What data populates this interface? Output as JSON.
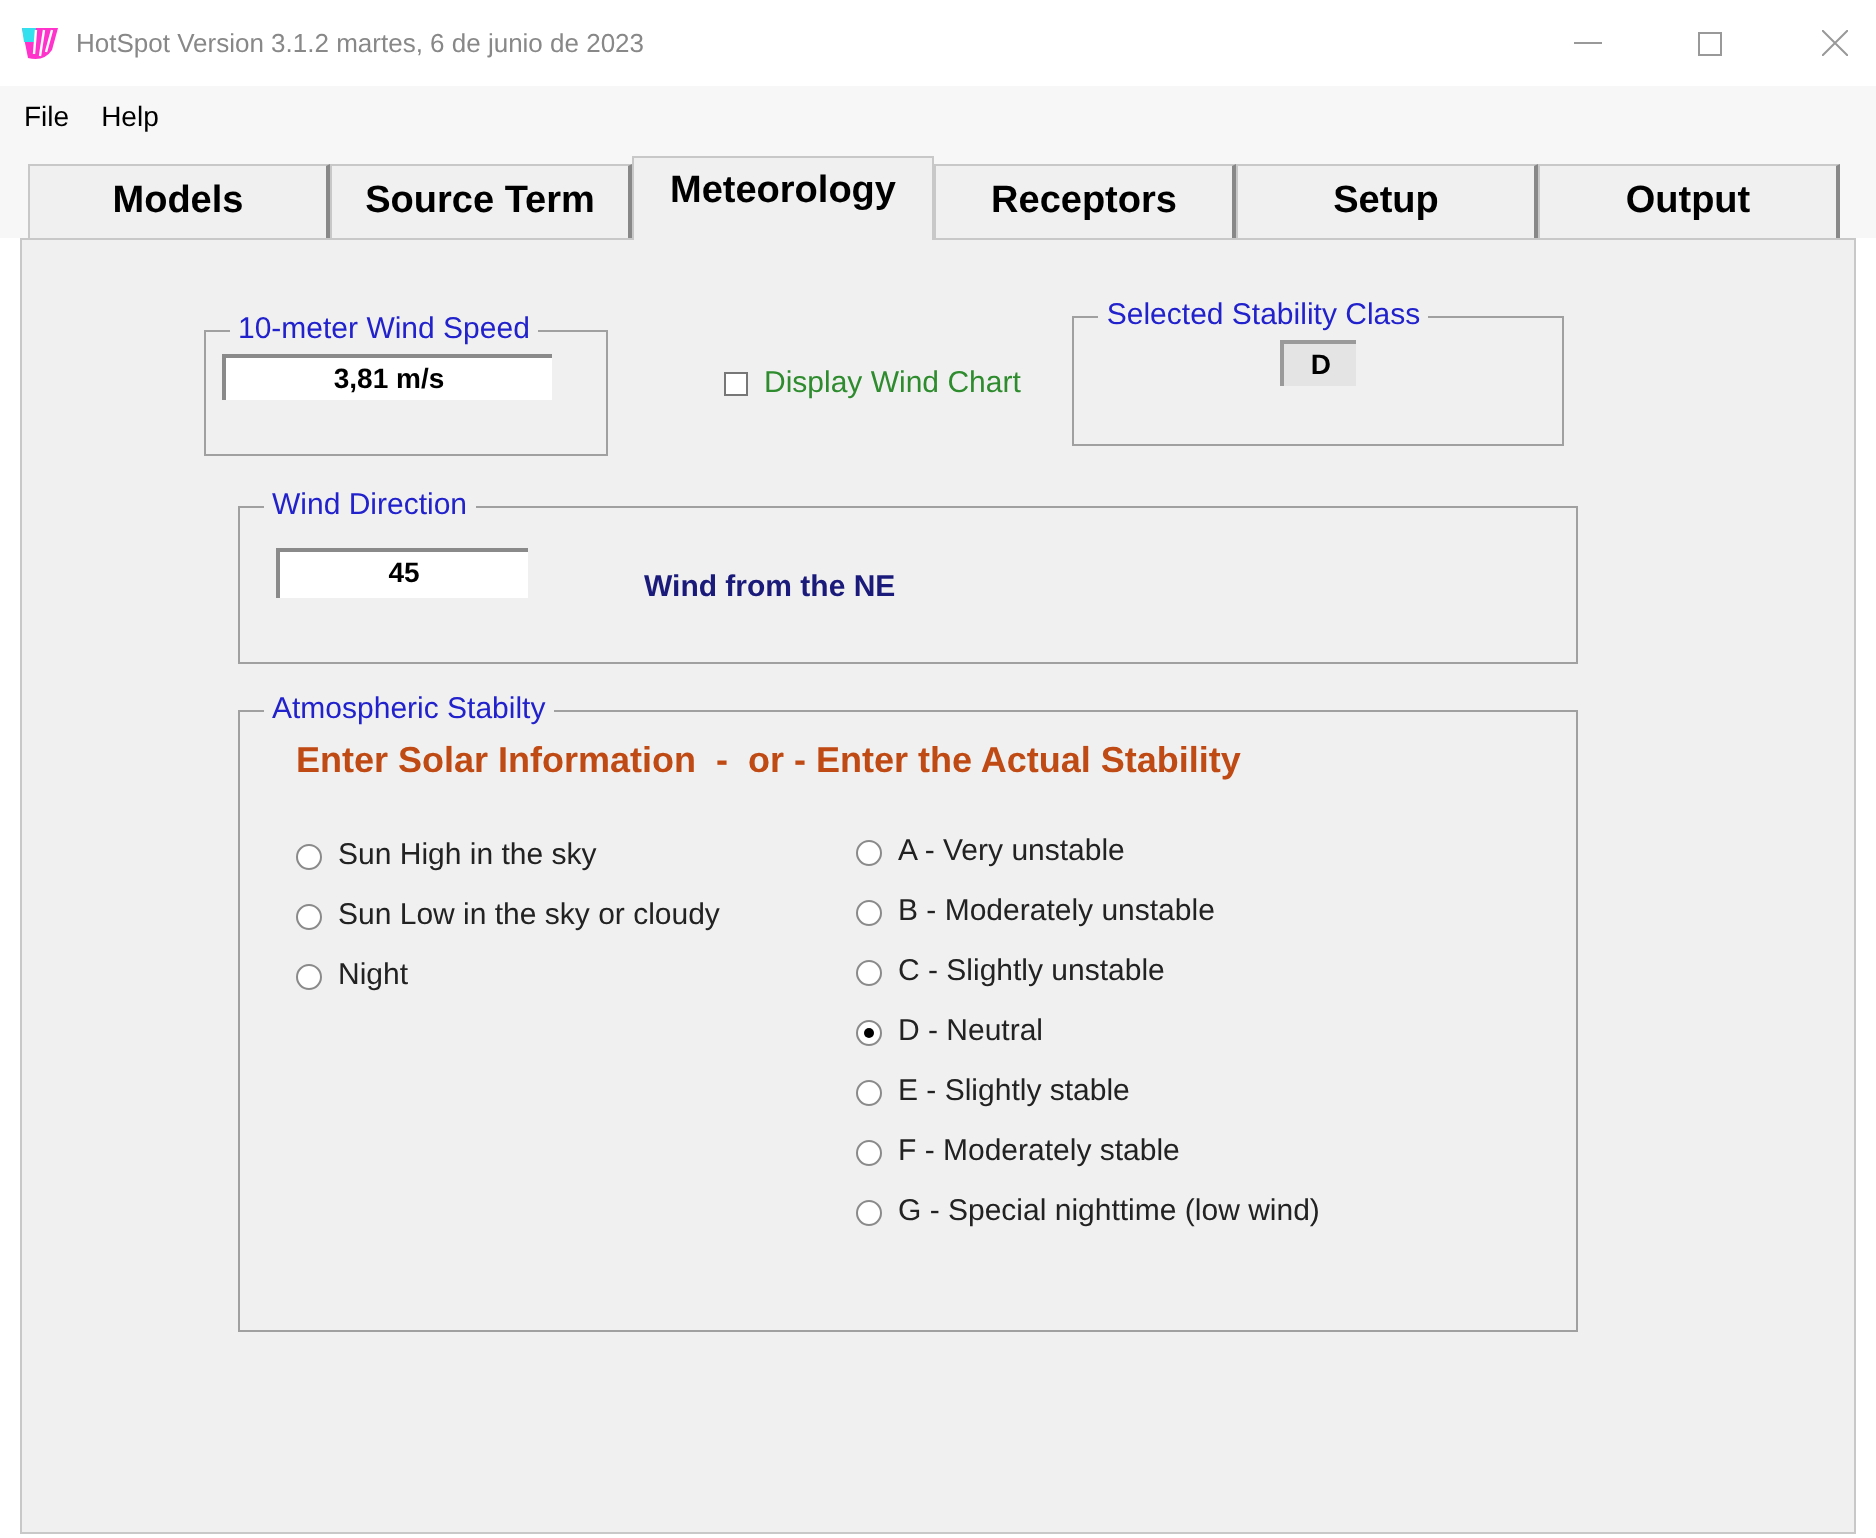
{
  "window": {
    "title": "HotSpot Version 3.1.2 martes, 6 de junio de 2023"
  },
  "menu": [
    "File",
    "Help"
  ],
  "tabs": [
    {
      "label": "Models",
      "selected": false
    },
    {
      "label": "Source Term",
      "selected": false
    },
    {
      "label": "Meteorology",
      "selected": true
    },
    {
      "label": "Receptors",
      "selected": false
    },
    {
      "label": "Setup",
      "selected": false
    },
    {
      "label": "Output",
      "selected": false
    }
  ],
  "wind_speed": {
    "label": "10-meter Wind Speed",
    "value": "3,81 m/s"
  },
  "wind_chart": {
    "label": "Display Wind Chart",
    "checked": false
  },
  "stability_class": {
    "label": "Selected Stability Class",
    "value": "D"
  },
  "wind_direction": {
    "label": "Wind Direction",
    "value": "45",
    "description": "Wind from the NE"
  },
  "atmospheric_stability": {
    "label": "Atmospheric Stabilty",
    "heading": "Enter Solar Information  -  or - Enter the Actual Stability",
    "solar_options": [
      {
        "label": "Sun High in the sky",
        "selected": false
      },
      {
        "label": "Sun Low in the sky or cloudy",
        "selected": false
      },
      {
        "label": "Night",
        "selected": false
      }
    ],
    "stability_options": [
      {
        "label": "A - Very unstable",
        "selected": false
      },
      {
        "label": "B - Moderately unstable",
        "selected": false
      },
      {
        "label": "C - Slightly unstable",
        "selected": false
      },
      {
        "label": "D - Neutral",
        "selected": true
      },
      {
        "label": "E - Slightly stable",
        "selected": false
      },
      {
        "label": "F - Moderately stable",
        "selected": false
      },
      {
        "label": "G - Special nighttime (low wind)",
        "selected": false
      }
    ]
  }
}
